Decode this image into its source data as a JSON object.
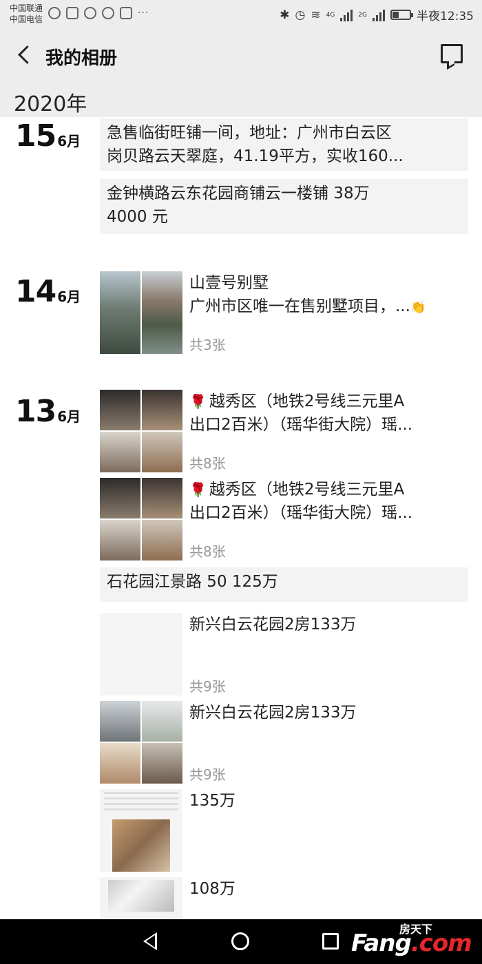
{
  "status_bar": {
    "carrier1": "中国联通",
    "carrier2": "中国电信",
    "network1": "4G",
    "network2": "2G",
    "time": "半夜12:35",
    "more_glyph": "···"
  },
  "header": {
    "title": "我的相册",
    "back_icon": "chevron-left-icon",
    "comment_icon": "comment-icon"
  },
  "year": "2020年",
  "groups": [
    {
      "day": "15",
      "month": "6月"
    },
    {
      "day": "14",
      "month": "6月"
    },
    {
      "day": "13",
      "month": "6月"
    }
  ],
  "posts": {
    "p1": {
      "line1": "急售临街旺铺一间，地址：广州市白云区",
      "line2": "岗贝路云天翠庭，41.19平方，实收160..."
    },
    "p2": {
      "line1": "金钟横路云东花园商铺云一楼铺  38万",
      "line2": "4000 元"
    },
    "p3": {
      "line1": "山壹号别墅",
      "line2": "广州市区唯一在售别墅项目，...",
      "count": "共3张"
    },
    "p4": {
      "line1": "越秀区（地铁2号线三元里A",
      "line2": "出口2百米）（瑶华街大院）瑶...",
      "count": "共8张"
    },
    "p5": {
      "line1": "越秀区（地铁2号线三元里A",
      "line2": "出口2百米）（瑶华街大院）瑶...",
      "count": "共8张"
    },
    "p6": {
      "line1": "石花园江景路   50  125万"
    },
    "p7": {
      "line1": "新兴白云花园2房133万",
      "count": "共9张"
    },
    "p8": {
      "line1": "新兴白云花园2房133万",
      "count": "共9张"
    },
    "p9": {
      "line1": "135万"
    },
    "p10": {
      "line1": "108万"
    }
  },
  "watermark": {
    "top": "房天下",
    "main_a": "Fang",
    "main_b": ".com"
  }
}
